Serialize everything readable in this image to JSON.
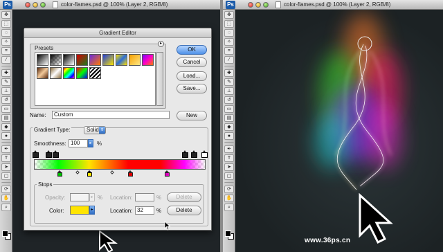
{
  "left_window": {
    "title": "color-flames.psd @ 100% (Layer 2, RGB/8)"
  },
  "right_window": {
    "title": "color-flames.psd @ 100% (Layer 2, RGB/8)"
  },
  "app_logo": "Ps",
  "watermark": "www.36ps.cn",
  "dialog": {
    "title": "Gradient Editor",
    "presets_label": "Presets",
    "buttons": {
      "ok": "OK",
      "cancel": "Cancel",
      "load": "Load...",
      "save": "Save...",
      "new": "New",
      "delete_opacity": "Delete",
      "delete_color": "Delete"
    },
    "name_label": "Name:",
    "name_value": "Custom",
    "gradient_type_label": "Gradient Type:",
    "gradient_type_value": "Solid",
    "smoothness_label": "Smoothness:",
    "smoothness_value": "100",
    "percent": "%",
    "stops_label": "Stops",
    "opacity_label": "Opacity:",
    "opacity_value": "",
    "location_label": "Location:",
    "opacity_location_value": "",
    "color_label": "Color:",
    "color_location_value": "32",
    "selected_color": "#ffe400"
  },
  "gradient": {
    "color_stops": [
      {
        "location": 14,
        "color": "#00ff00"
      },
      {
        "location": 32,
        "color": "#ffe400"
      },
      {
        "location": 55,
        "color": "#ff0000"
      },
      {
        "location": 74,
        "color": "#ff0000"
      },
      {
        "location": 88,
        "color": "#ff00ff"
      }
    ],
    "opacity_stops": [
      0,
      8,
      12,
      85,
      91,
      98
    ]
  },
  "colors": {
    "accent": "#4f91e8",
    "dialog_bg": "#e8e8e8",
    "canvas_bg": "#1f2427"
  }
}
